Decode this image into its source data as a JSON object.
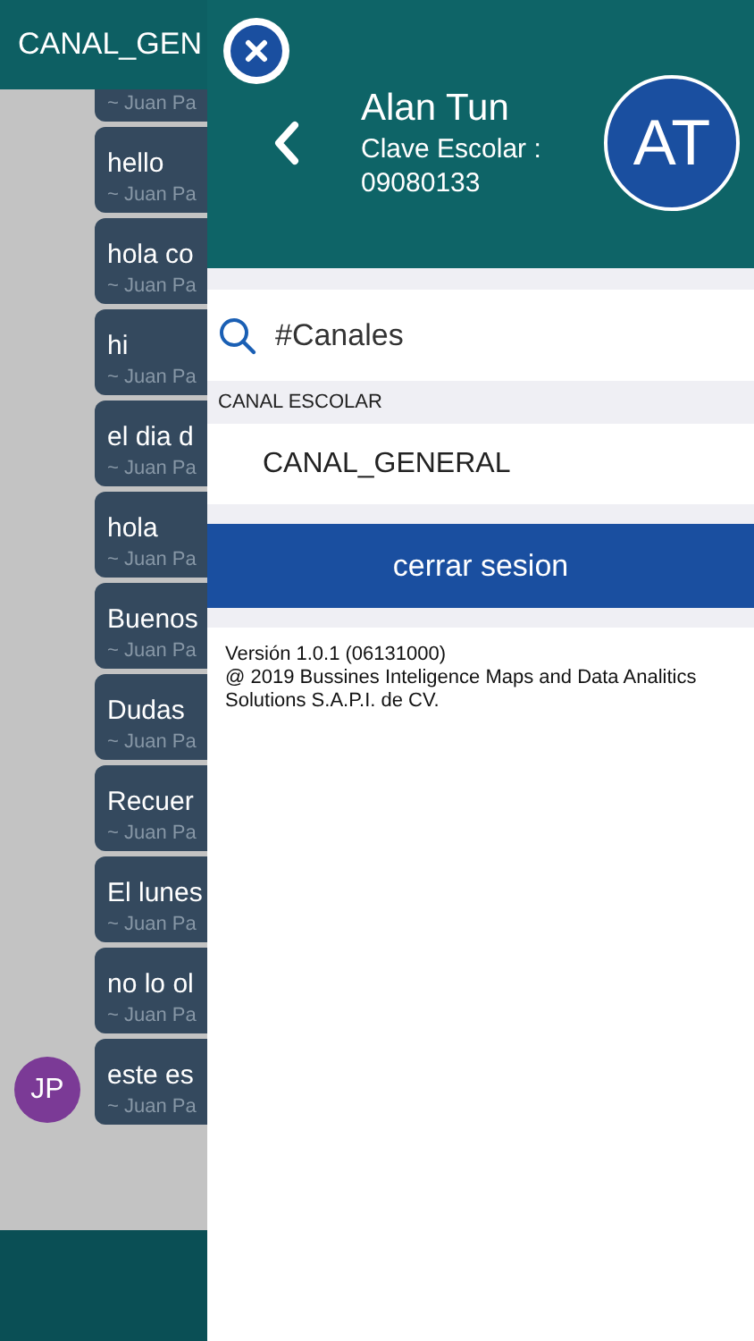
{
  "chat": {
    "title": "CANAL_GEN",
    "messages": [
      {
        "author": "~ Juan Pa"
      },
      {
        "text": "hello",
        "author": "~ Juan Pa"
      },
      {
        "text": "hola co",
        "author": "~ Juan Pa"
      },
      {
        "text": "hi",
        "author": "~ Juan Pa"
      },
      {
        "text": "el dia d",
        "author": "~ Juan Pa"
      },
      {
        "text": "hola",
        "author": "~ Juan Pa"
      },
      {
        "text": "Buenos",
        "author": "~ Juan Pa"
      },
      {
        "text": "Dudas",
        "author": "~ Juan Pa"
      },
      {
        "text": "Recuer",
        "author": "~ Juan Pa"
      },
      {
        "text": "El lunes",
        "author": "~ Juan Pa"
      },
      {
        "text": "no lo ol",
        "author": "~ Juan Pa"
      },
      {
        "text": "este es",
        "author": "~ Juan Pa",
        "avatar": "JP"
      }
    ]
  },
  "drawer": {
    "user": {
      "name": "Alan Tun",
      "label": "Clave Escolar :",
      "id": "09080133",
      "initials": "AT"
    },
    "search": {
      "placeholder": "#Canales"
    },
    "section": "CANAL ESCOLAR",
    "channels": [
      "CANAL_GENERAL"
    ],
    "logout": "cerrar sesion",
    "version": "Versión 1.0.1 (06131000)",
    "copyright": "@ 2019 Bussines Inteligence Maps and Data Analitics Solutions S.A.P.I. de CV."
  }
}
